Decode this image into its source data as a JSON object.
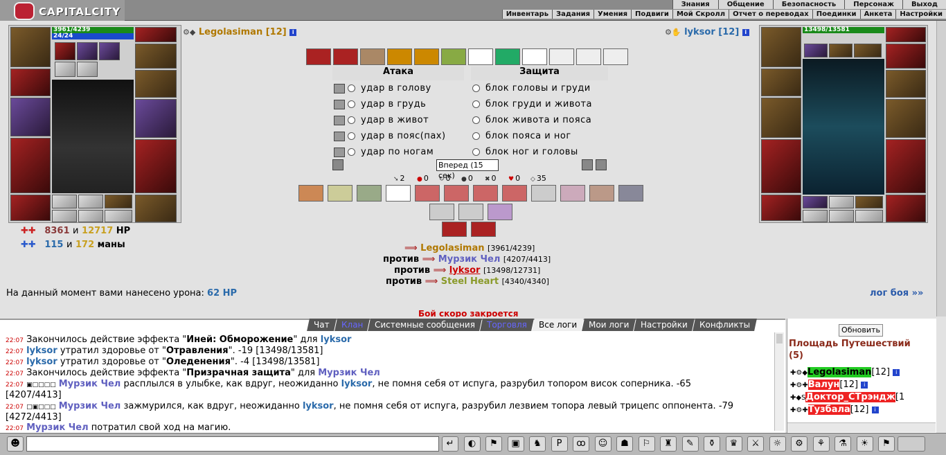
{
  "top": {
    "logo": "CAPITALCITY",
    "menu1": [
      "Знания",
      "Общение",
      "Безопасность",
      "Персонаж",
      "Выход"
    ],
    "menu2": [
      "Инвентарь",
      "Задания",
      "Умения",
      "Подвиги",
      "Мой Скролл",
      "Отчет о переводах",
      "Поединки",
      "Анкета",
      "Настройки"
    ]
  },
  "player": {
    "name": "Legolasiman",
    "level": "[12]",
    "hp": "3961/4239",
    "mana": "24/24",
    "hp_fraction": 0.934
  },
  "enemy": {
    "name": "lyksor",
    "level": "[12]",
    "hp": "13498/13581",
    "hp_fraction": 0.994
  },
  "combat": {
    "attack_title": "Атака",
    "defense_title": "Защита",
    "attacks": [
      "удар в голову",
      "удар в грудь",
      "удар в живот",
      "удар в пояс(пах)",
      "удар по ногам"
    ],
    "blocks": [
      "блок головы и груди",
      "блок груди и живота",
      "блок живота и пояса",
      "блок пояса и ног",
      "блок ног и головы"
    ],
    "forward_btn": "Вперед (15 сек)",
    "counters": [
      "2",
      "0",
      "0",
      "0",
      "0",
      "0",
      "35"
    ]
  },
  "hpstats": {
    "hp_cur": "8361",
    "and": "и",
    "hp_max": "12717",
    "hp_unit": "HP",
    "mana_cur": "115",
    "mana_max": "172",
    "mana_unit": "маны"
  },
  "versus": {
    "me": "Legolasiman",
    "me_hp": "[3961/4239]",
    "against": "против",
    "op1": "Мурзик Чел",
    "op1_hp": "[4207/4413]",
    "op2": "lyksor",
    "op2_hp": "[13498/12731]",
    "op3": "Steel Heart",
    "op3_hp": "[4340/4340]"
  },
  "damage": {
    "label": "На данный момент вами нанесено урона:",
    "value": "62 HP",
    "log_link": "лог боя »»",
    "closing": "Бой скоро закроется"
  },
  "tabs": [
    "Чат",
    "Клан",
    "Системные сообщения",
    "Торговля",
    "Все логи",
    "Мои логи",
    "Настройки",
    "Конфликты"
  ],
  "log": [
    {
      "t": "22:07",
      "a": "Закончилось действие эффекта \"",
      "b": "Иней: Обморожение",
      "c": "\" для ",
      "d": "lyksor"
    },
    {
      "t": "22:07",
      "a": "lyksor",
      "b": " утратил здоровье от \"",
      "c": "Отравления",
      "d": "\". -19 [13498/13581]"
    },
    {
      "t": "22:07",
      "a": "lyksor",
      "b": " утратил здоровье от \"",
      "c": "Оледенения",
      "d": "\". -4 [13498/13581]"
    },
    {
      "t": "22:07",
      "a": "Закончилось действие эффекта \"",
      "b": "Призрачная защита",
      "c": "\" для ",
      "d": "Мурзик Чел"
    },
    {
      "t": "22:07",
      "a": "Мурзик Чел",
      "b": " расплылся в улыбке, как вдруг, неожиданно ",
      "c": "lyksor",
      "d": ", не помня себя от испуга, разрубил топором висок соперника. -65"
    },
    {
      "t": "",
      "a": "[4207/4413]",
      "b": "",
      "c": "",
      "d": ""
    },
    {
      "t": "22:07",
      "a": "Мурзик Чел",
      "b": " зажмурился, как вдруг, неожиданно ",
      "c": "lyksor",
      "d": ", не помня себя от испуга, разрубил лезвием топора левый трицепс оппонента. -79"
    },
    {
      "t": "",
      "a": "[4272/4413]",
      "b": "",
      "c": "",
      "d": ""
    },
    {
      "t": "22:07",
      "a": "Мурзик Чел",
      "b": " потратил свой ход на магию.",
      "c": "",
      "d": ""
    }
  ],
  "right": {
    "refresh": "Обновить",
    "location": "Площадь Путешествий",
    "count": "(5)",
    "users": [
      {
        "n": "Legolasiman",
        "l": "[12]"
      },
      {
        "n": "Валун",
        "l": "[12]"
      },
      {
        "n": "Доктор_СТрэндж",
        "l": "[1"
      },
      {
        "n": "Тузбала",
        "l": "[12]"
      }
    ]
  }
}
